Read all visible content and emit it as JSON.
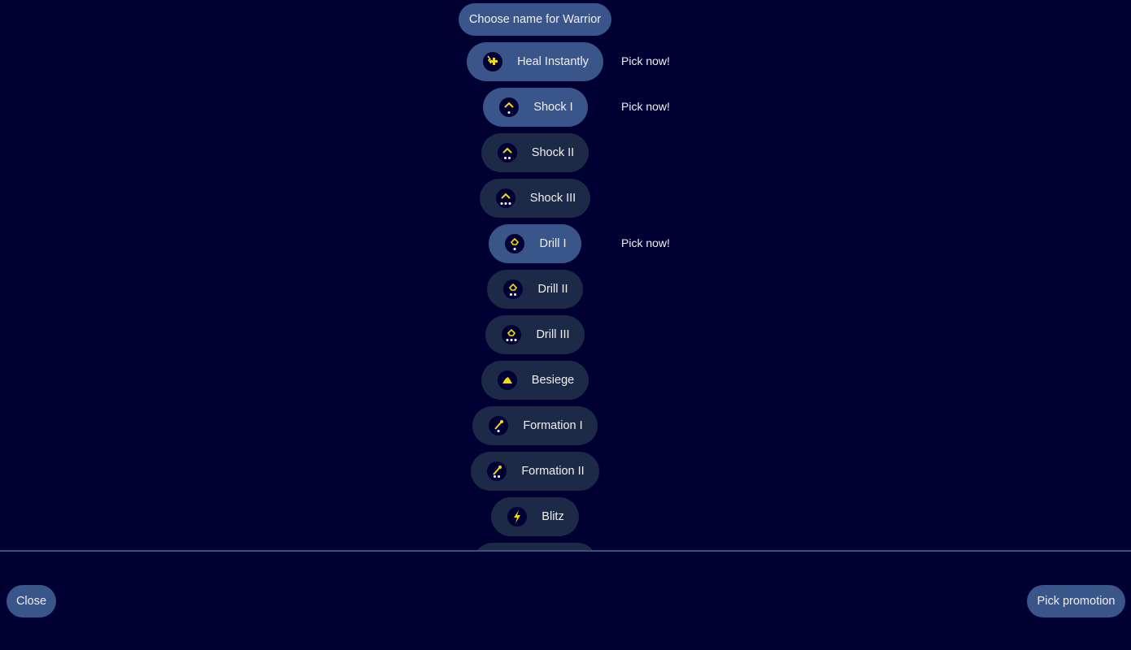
{
  "header": {
    "title": "Choose name for Warrior"
  },
  "promotions": [
    {
      "label": "Heal Instantly",
      "icon": "heal-icon",
      "stars": 0,
      "selected": true,
      "status": "Pick now!"
    },
    {
      "label": "Shock I",
      "icon": "shock-icon",
      "stars": 1,
      "selected": true,
      "status": "Pick now!"
    },
    {
      "label": "Shock II",
      "icon": "shock-icon",
      "stars": 2,
      "selected": false,
      "status": ""
    },
    {
      "label": "Shock III",
      "icon": "shock-icon",
      "stars": 3,
      "selected": false,
      "status": ""
    },
    {
      "label": "Drill I",
      "icon": "drill-icon",
      "stars": 1,
      "selected": true,
      "status": "Pick now!"
    },
    {
      "label": "Drill II",
      "icon": "drill-icon",
      "stars": 2,
      "selected": false,
      "status": ""
    },
    {
      "label": "Drill III",
      "icon": "drill-icon",
      "stars": 3,
      "selected": false,
      "status": ""
    },
    {
      "label": "Besiege",
      "icon": "besiege-icon",
      "stars": 0,
      "selected": false,
      "status": ""
    },
    {
      "label": "Formation I",
      "icon": "formation-icon",
      "stars": 1,
      "selected": false,
      "status": ""
    },
    {
      "label": "Formation II",
      "icon": "formation-icon",
      "stars": 2,
      "selected": false,
      "status": ""
    },
    {
      "label": "Blitz",
      "icon": "blitz-icon",
      "stars": 0,
      "selected": false,
      "status": ""
    }
  ],
  "footer": {
    "close_label": "Close",
    "pick_label": "Pick promotion"
  },
  "colors": {
    "background": "#000033",
    "selected": "#3a5589",
    "unselected": "#1c2a48",
    "icon_yellow": "#f5d90a"
  }
}
